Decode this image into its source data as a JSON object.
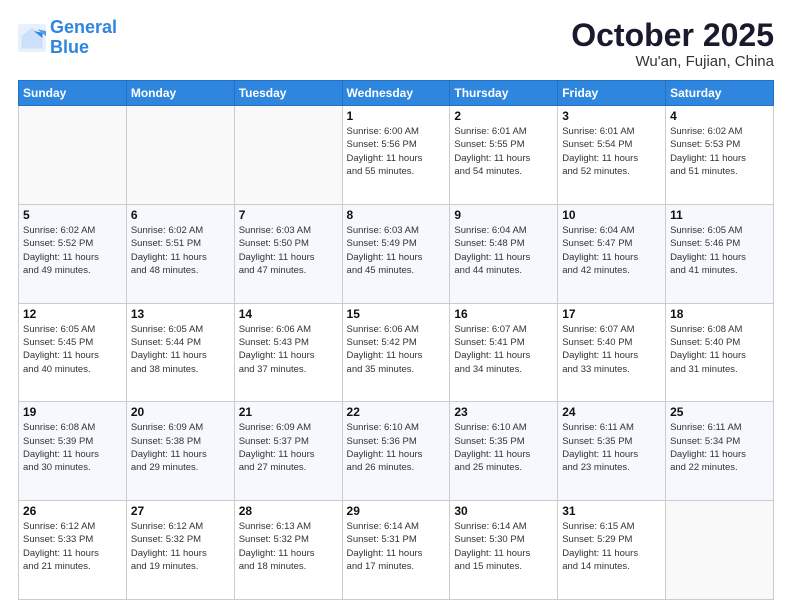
{
  "logo": {
    "line1": "General",
    "line2": "Blue"
  },
  "header": {
    "month": "October 2025",
    "location": "Wu'an, Fujian, China"
  },
  "weekdays": [
    "Sunday",
    "Monday",
    "Tuesday",
    "Wednesday",
    "Thursday",
    "Friday",
    "Saturday"
  ],
  "weeks": [
    [
      {
        "day": "",
        "info": ""
      },
      {
        "day": "",
        "info": ""
      },
      {
        "day": "",
        "info": ""
      },
      {
        "day": "1",
        "info": "Sunrise: 6:00 AM\nSunset: 5:56 PM\nDaylight: 11 hours\nand 55 minutes."
      },
      {
        "day": "2",
        "info": "Sunrise: 6:01 AM\nSunset: 5:55 PM\nDaylight: 11 hours\nand 54 minutes."
      },
      {
        "day": "3",
        "info": "Sunrise: 6:01 AM\nSunset: 5:54 PM\nDaylight: 11 hours\nand 52 minutes."
      },
      {
        "day": "4",
        "info": "Sunrise: 6:02 AM\nSunset: 5:53 PM\nDaylight: 11 hours\nand 51 minutes."
      }
    ],
    [
      {
        "day": "5",
        "info": "Sunrise: 6:02 AM\nSunset: 5:52 PM\nDaylight: 11 hours\nand 49 minutes."
      },
      {
        "day": "6",
        "info": "Sunrise: 6:02 AM\nSunset: 5:51 PM\nDaylight: 11 hours\nand 48 minutes."
      },
      {
        "day": "7",
        "info": "Sunrise: 6:03 AM\nSunset: 5:50 PM\nDaylight: 11 hours\nand 47 minutes."
      },
      {
        "day": "8",
        "info": "Sunrise: 6:03 AM\nSunset: 5:49 PM\nDaylight: 11 hours\nand 45 minutes."
      },
      {
        "day": "9",
        "info": "Sunrise: 6:04 AM\nSunset: 5:48 PM\nDaylight: 11 hours\nand 44 minutes."
      },
      {
        "day": "10",
        "info": "Sunrise: 6:04 AM\nSunset: 5:47 PM\nDaylight: 11 hours\nand 42 minutes."
      },
      {
        "day": "11",
        "info": "Sunrise: 6:05 AM\nSunset: 5:46 PM\nDaylight: 11 hours\nand 41 minutes."
      }
    ],
    [
      {
        "day": "12",
        "info": "Sunrise: 6:05 AM\nSunset: 5:45 PM\nDaylight: 11 hours\nand 40 minutes."
      },
      {
        "day": "13",
        "info": "Sunrise: 6:05 AM\nSunset: 5:44 PM\nDaylight: 11 hours\nand 38 minutes."
      },
      {
        "day": "14",
        "info": "Sunrise: 6:06 AM\nSunset: 5:43 PM\nDaylight: 11 hours\nand 37 minutes."
      },
      {
        "day": "15",
        "info": "Sunrise: 6:06 AM\nSunset: 5:42 PM\nDaylight: 11 hours\nand 35 minutes."
      },
      {
        "day": "16",
        "info": "Sunrise: 6:07 AM\nSunset: 5:41 PM\nDaylight: 11 hours\nand 34 minutes."
      },
      {
        "day": "17",
        "info": "Sunrise: 6:07 AM\nSunset: 5:40 PM\nDaylight: 11 hours\nand 33 minutes."
      },
      {
        "day": "18",
        "info": "Sunrise: 6:08 AM\nSunset: 5:40 PM\nDaylight: 11 hours\nand 31 minutes."
      }
    ],
    [
      {
        "day": "19",
        "info": "Sunrise: 6:08 AM\nSunset: 5:39 PM\nDaylight: 11 hours\nand 30 minutes."
      },
      {
        "day": "20",
        "info": "Sunrise: 6:09 AM\nSunset: 5:38 PM\nDaylight: 11 hours\nand 29 minutes."
      },
      {
        "day": "21",
        "info": "Sunrise: 6:09 AM\nSunset: 5:37 PM\nDaylight: 11 hours\nand 27 minutes."
      },
      {
        "day": "22",
        "info": "Sunrise: 6:10 AM\nSunset: 5:36 PM\nDaylight: 11 hours\nand 26 minutes."
      },
      {
        "day": "23",
        "info": "Sunrise: 6:10 AM\nSunset: 5:35 PM\nDaylight: 11 hours\nand 25 minutes."
      },
      {
        "day": "24",
        "info": "Sunrise: 6:11 AM\nSunset: 5:35 PM\nDaylight: 11 hours\nand 23 minutes."
      },
      {
        "day": "25",
        "info": "Sunrise: 6:11 AM\nSunset: 5:34 PM\nDaylight: 11 hours\nand 22 minutes."
      }
    ],
    [
      {
        "day": "26",
        "info": "Sunrise: 6:12 AM\nSunset: 5:33 PM\nDaylight: 11 hours\nand 21 minutes."
      },
      {
        "day": "27",
        "info": "Sunrise: 6:12 AM\nSunset: 5:32 PM\nDaylight: 11 hours\nand 19 minutes."
      },
      {
        "day": "28",
        "info": "Sunrise: 6:13 AM\nSunset: 5:32 PM\nDaylight: 11 hours\nand 18 minutes."
      },
      {
        "day": "29",
        "info": "Sunrise: 6:14 AM\nSunset: 5:31 PM\nDaylight: 11 hours\nand 17 minutes."
      },
      {
        "day": "30",
        "info": "Sunrise: 6:14 AM\nSunset: 5:30 PM\nDaylight: 11 hours\nand 15 minutes."
      },
      {
        "day": "31",
        "info": "Sunrise: 6:15 AM\nSunset: 5:29 PM\nDaylight: 11 hours\nand 14 minutes."
      },
      {
        "day": "",
        "info": ""
      }
    ]
  ]
}
